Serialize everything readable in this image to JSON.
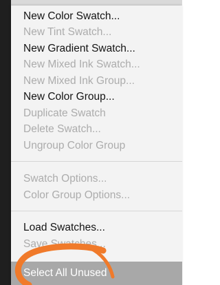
{
  "menu": {
    "items": [
      {
        "label": "New Color Swatch...",
        "enabled": true
      },
      {
        "label": "New Tint Swatch...",
        "enabled": false
      },
      {
        "label": "New Gradient Swatch...",
        "enabled": true
      },
      {
        "label": "New Mixed Ink Swatch...",
        "enabled": false
      },
      {
        "label": "New Mixed Ink Group...",
        "enabled": false
      },
      {
        "label": "New Color Group...",
        "enabled": true
      },
      {
        "label": "Duplicate Swatch",
        "enabled": false
      },
      {
        "label": "Delete Swatch...",
        "enabled": false
      },
      {
        "label": "Ungroup Color Group",
        "enabled": false
      },
      {
        "label": "Swatch Options...",
        "enabled": false
      },
      {
        "label": "Color Group Options...",
        "enabled": false
      },
      {
        "label": "Load Swatches...",
        "enabled": true
      },
      {
        "label": "Save Swatches...",
        "enabled": false
      },
      {
        "label": "Select All Unused",
        "enabled": true,
        "highlighted": true
      }
    ]
  },
  "annotation": {
    "color": "#f07a2a"
  }
}
